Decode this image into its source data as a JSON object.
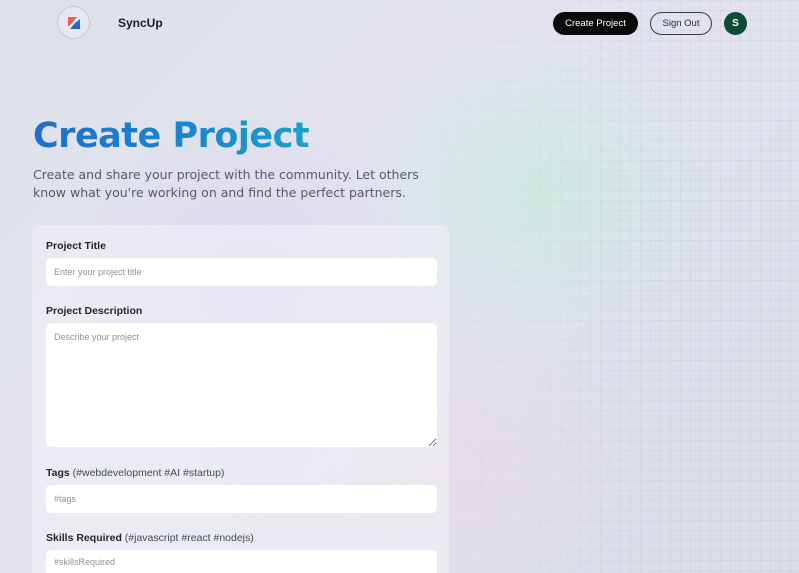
{
  "header": {
    "logo_icon": "syncup-logo-icon",
    "brand": "SyncUp",
    "create_project_label": "Create Project",
    "sign_out_label": "Sign Out",
    "avatar_initial": "S",
    "avatar_color": "#0e4a3a"
  },
  "hero": {
    "title": "Create Project",
    "subtitle": "Create and share your project with the community. Let others know what you're working on and find the perfect partners."
  },
  "form": {
    "title_label": "Project Title",
    "title_placeholder": "Enter your project title",
    "description_label": "Project Description",
    "description_placeholder": "Describe your project",
    "tags_label": "Tags",
    "tags_hint": "(#webdevelopment #AI #startup)",
    "tags_placeholder": "#tags",
    "skills_label": "Skills Required",
    "skills_hint": "(#javascript #react #nodejs)",
    "skills_placeholder": "#skillsRequired"
  },
  "colors": {
    "title_gradient_start": "#1f6fc8",
    "title_gradient_end": "#1ba0c8",
    "primary_button": "#0b0b0c"
  }
}
